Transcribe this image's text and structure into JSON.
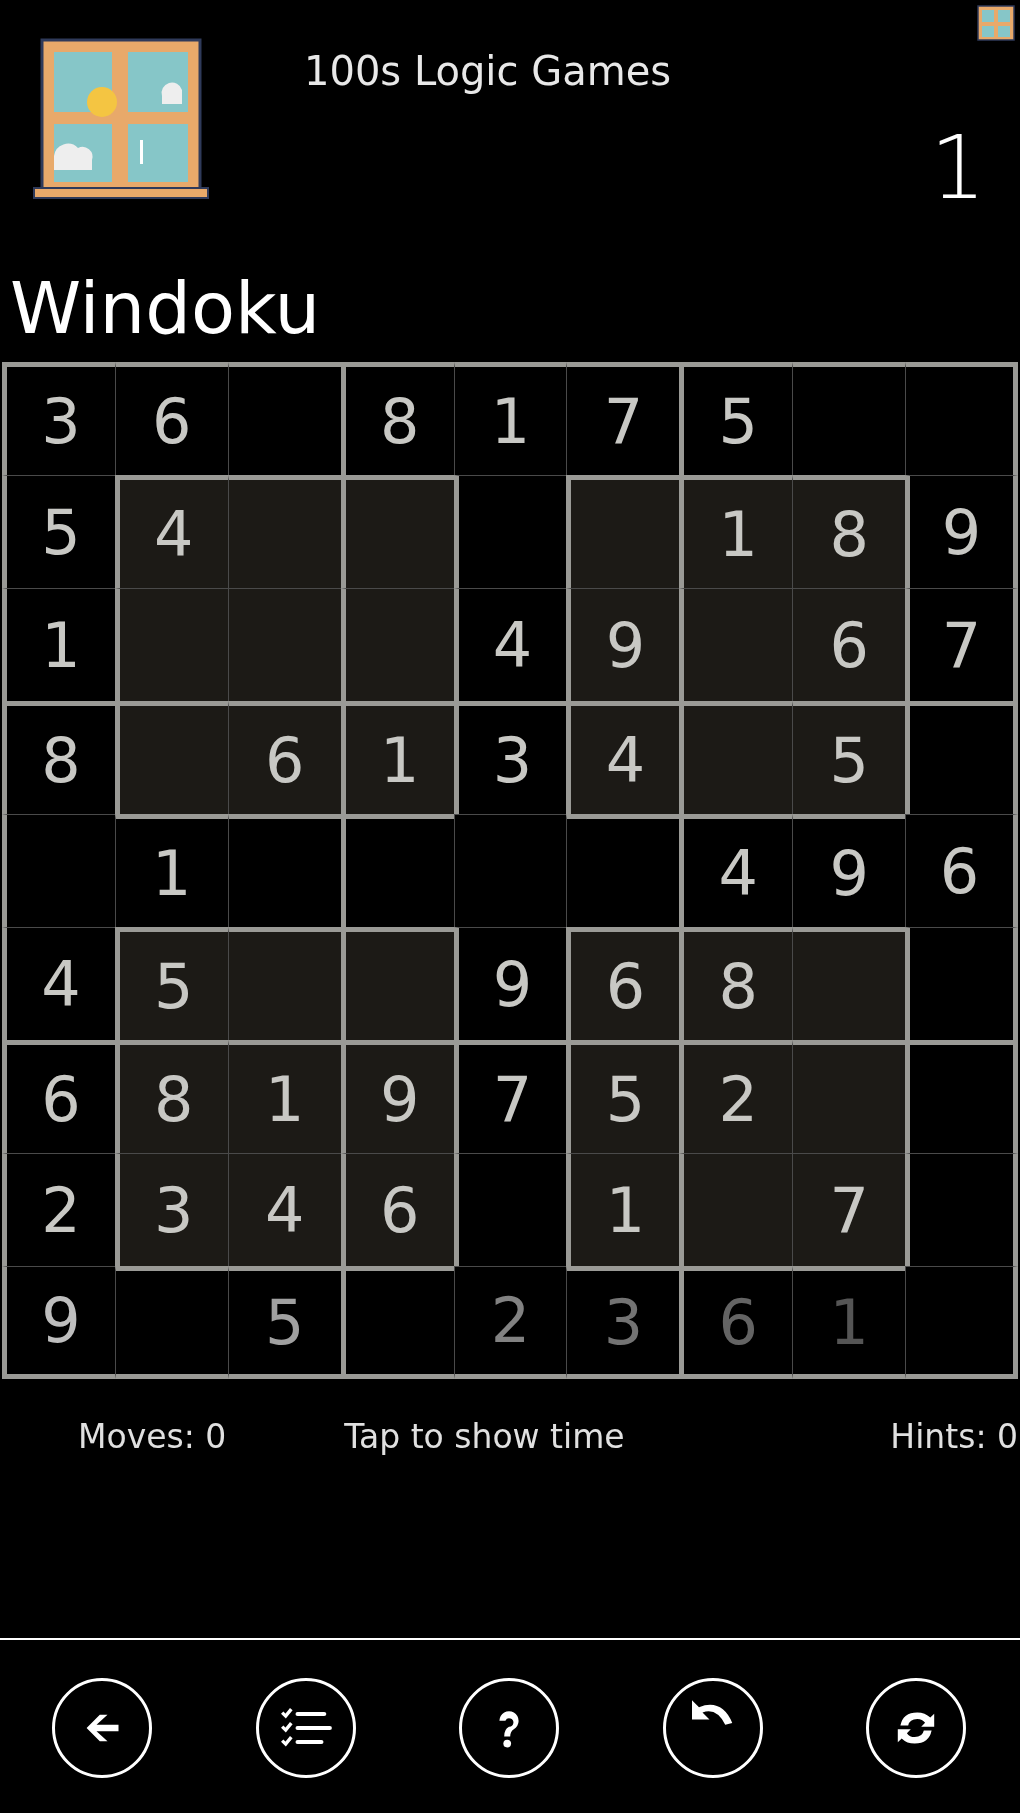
{
  "header": {
    "app_title": "100s Logic Games",
    "puzzle_number": "1"
  },
  "puzzle_title": "Windoku",
  "grid": [
    {
      "cells": [
        {
          "value": "3",
          "shaded": false
        },
        {
          "value": "6",
          "shaded": false
        },
        {
          "shaded": false
        },
        {
          "value": "8",
          "shaded": false
        },
        {
          "value": "1",
          "shaded": false
        },
        {
          "value": "7",
          "shaded": false
        },
        {
          "value": "5",
          "shaded": false
        },
        {
          "shaded": false
        },
        {
          "shaded": false
        }
      ]
    },
    {
      "cells": [
        {
          "value": "5",
          "shaded": false
        },
        {
          "value": "4",
          "shaded": true
        },
        {
          "shaded": true
        },
        {
          "shaded": true
        },
        {
          "shaded": false
        },
        {
          "shaded": true
        },
        {
          "value": "1",
          "shaded": true
        },
        {
          "value": "8",
          "shaded": true
        },
        {
          "value": "9",
          "shaded": false
        }
      ]
    },
    {
      "cells": [
        {
          "value": "1",
          "shaded": false
        },
        {
          "shaded": true
        },
        {
          "shaded": true
        },
        {
          "shaded": true
        },
        {
          "value": "4",
          "shaded": false
        },
        {
          "value": "9",
          "shaded": true
        },
        {
          "shaded": true
        },
        {
          "value": "6",
          "shaded": true
        },
        {
          "value": "7",
          "shaded": false
        }
      ]
    },
    {
      "cells": [
        {
          "value": "8",
          "shaded": false
        },
        {
          "shaded": true
        },
        {
          "value": "6",
          "shaded": true
        },
        {
          "value": "1",
          "shaded": true
        },
        {
          "value": "3",
          "shaded": false
        },
        {
          "value": "4",
          "shaded": true
        },
        {
          "shaded": true
        },
        {
          "value": "5",
          "shaded": true
        },
        {
          "shaded": false
        }
      ]
    },
    {
      "cells": [
        {
          "shaded": false
        },
        {
          "value": "1",
          "shaded": false
        },
        {
          "shaded": false
        },
        {
          "shaded": false
        },
        {
          "shaded": false
        },
        {
          "shaded": false
        },
        {
          "value": "4",
          "shaded": false
        },
        {
          "value": "9",
          "shaded": false
        },
        {
          "value": "6",
          "shaded": false
        }
      ]
    },
    {
      "cells": [
        {
          "value": "4",
          "shaded": false
        },
        {
          "value": "5",
          "shaded": true
        },
        {
          "shaded": true
        },
        {
          "shaded": true
        },
        {
          "value": "9",
          "shaded": false
        },
        {
          "value": "6",
          "shaded": true
        },
        {
          "value": "8",
          "shaded": true
        },
        {
          "shaded": true
        },
        {
          "shaded": false
        }
      ]
    },
    {
      "cells": [
        {
          "value": "6",
          "shaded": false
        },
        {
          "value": "8",
          "shaded": true
        },
        {
          "value": "1",
          "shaded": true
        },
        {
          "value": "9",
          "shaded": true
        },
        {
          "value": "7",
          "shaded": false
        },
        {
          "value": "5",
          "shaded": true
        },
        {
          "value": "2",
          "shaded": true
        },
        {
          "shaded": true
        },
        {
          "shaded": false
        }
      ]
    },
    {
      "cells": [
        {
          "value": "2",
          "shaded": false
        },
        {
          "value": "3",
          "shaded": true
        },
        {
          "value": "4",
          "shaded": true
        },
        {
          "value": "6",
          "shaded": true
        },
        {
          "shaded": false
        },
        {
          "value": "1",
          "shaded": true
        },
        {
          "shaded": true
        },
        {
          "value": "7",
          "shaded": true
        },
        {
          "shaded": false
        }
      ]
    },
    {
      "faded": true,
      "cells": [
        {
          "value": "9",
          "shaded": false
        },
        {
          "shaded": false
        },
        {
          "value": "5",
          "shaded": false
        },
        {
          "shaded": false
        },
        {
          "value": "2",
          "shaded": false
        },
        {
          "value": "3",
          "shaded": false
        },
        {
          "value": "6",
          "shaded": false
        },
        {
          "value": "1",
          "shaded": false
        },
        {
          "shaded": false
        }
      ]
    }
  ],
  "status": {
    "moves": "Moves: 0",
    "timer": "Tap to show time",
    "hints": "Hints: 0"
  },
  "toolbar": [
    {
      "kind": "back"
    },
    {
      "kind": "list"
    },
    {
      "kind": "help"
    },
    {
      "kind": "undo"
    },
    {
      "kind": "restart"
    }
  ]
}
